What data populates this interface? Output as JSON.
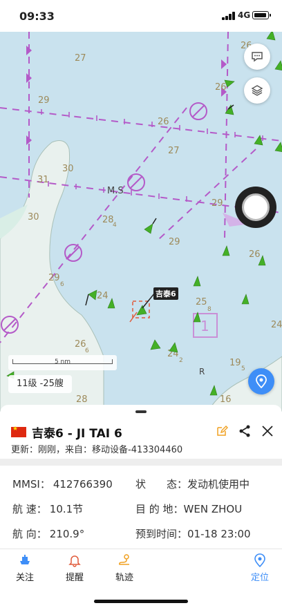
{
  "status": {
    "time": "09:33",
    "network": "4G"
  },
  "map": {
    "depths": [
      "27",
      "26",
      "29",
      "26",
      "30",
      "31",
      "27",
      "30",
      "29",
      "28",
      "4",
      "29",
      "26",
      "29",
      "6",
      "24",
      "26",
      "25",
      "8",
      "26",
      "6",
      "24",
      "2",
      "19",
      "5",
      "24",
      "28",
      "16"
    ],
    "place_labels": [
      "M.S",
      "R"
    ],
    "scale_label": "5 nm",
    "zoom_info": "11级 -25艘",
    "selected_ship_tag": "吉泰6",
    "icons": [
      "chat-icon",
      "layers-icon",
      "locate-icon"
    ]
  },
  "ship": {
    "flag": "china-flag",
    "name": "吉泰6 - JI TAI 6",
    "update": "更新：刚刚，来自：移动设备-413304460",
    "mmsi_label": "MMSI：",
    "mmsi_value": "412766390",
    "status_label": "状　　态：",
    "status_value": "发动机使用中",
    "speed_label": "航 速：",
    "speed_value": "10.1节",
    "dest_label": "目 的 地：",
    "dest_value": "WEN ZHOU",
    "course_label": "航 向：",
    "course_value": "210.9°",
    "eta_label": "预到时间：",
    "eta_value": "01-18 23:00"
  },
  "tabs": [
    {
      "label": "关注",
      "icon": "follow-icon"
    },
    {
      "label": "提醒",
      "icon": "bell-icon"
    },
    {
      "label": "轨迹",
      "icon": "track-icon"
    },
    {
      "label": "定位",
      "icon": "locate-icon"
    }
  ],
  "colors": {
    "accent": "#3e8ef7",
    "sea": "#c9e2ee",
    "land": "#e8f0ee",
    "route": "#b45ac8",
    "ship": "#44b027"
  }
}
